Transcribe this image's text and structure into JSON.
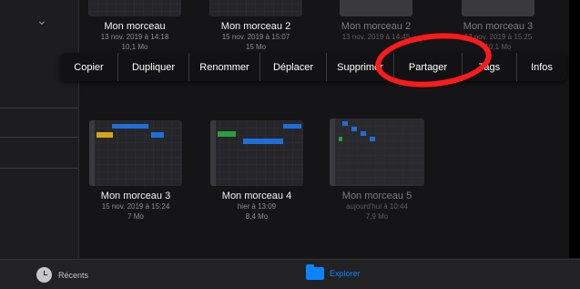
{
  "documents_row1": [
    {
      "title": "Mon morceau",
      "date": "13 nov. 2019 à 14:18",
      "size": "10,1 Mo"
    },
    {
      "title": "Mon morceau 2",
      "date": "15 nov. 2019 à 15:07",
      "size": "15 Mo"
    },
    {
      "title": "Mon morceau 2",
      "date": "13 nov. 2019 à 14:45",
      "size": ""
    },
    {
      "title": "Mon morceau 3",
      "date": "13 nov. 2019 à 15:25",
      "size": "10,1 Mo"
    }
  ],
  "context_menu": {
    "items": [
      "Copier",
      "Dupliquer",
      "Renommer",
      "Déplacer",
      "Supprimer",
      "Partager",
      "Tags",
      "Infos"
    ]
  },
  "documents_row2": [
    {
      "title": "Mon morceau 3",
      "date": "15 nov. 2019 à 15:24",
      "size": "7 Mo"
    },
    {
      "title": "Mon morceau 4",
      "date": "hier à 13:09",
      "size": "8,4 Mo"
    },
    {
      "title": "Mon morceau 5",
      "date": "aujourd'hui à 10:44",
      "size": "7,9 Mo"
    }
  ],
  "tabbar": {
    "recents_label": "Récents",
    "explorer_label": "Explorer",
    "active_color": "#0a84ff"
  },
  "annotation_color": "#ff1a1a"
}
